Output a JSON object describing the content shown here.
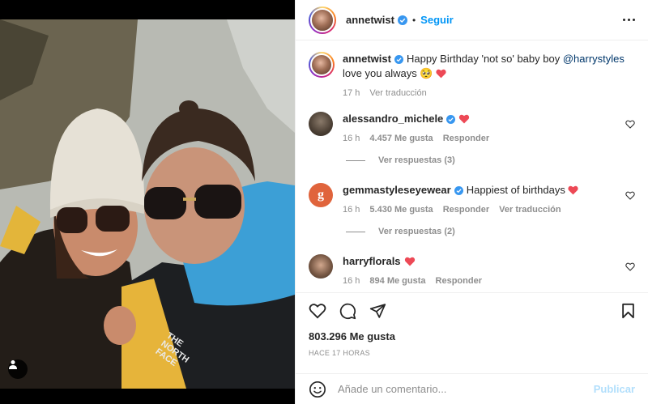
{
  "post": {
    "author": "annetwist",
    "follow_label": "Seguir",
    "caption_user": "annetwist",
    "caption_text": "Happy Birthday 'not so' baby boy",
    "caption_mention": "@harrystyles",
    "caption_tail": "love you always",
    "caption_emoji": "🥺",
    "caption_time": "17 h",
    "caption_translate": "Ver traducción",
    "likes": "803.296 Me gusta",
    "time_ago": "HACE 17 HORAS"
  },
  "comments": [
    {
      "user": "alessandro_michele",
      "verified": true,
      "text": "",
      "time": "16 h",
      "likes": "4.457 Me gusta",
      "reply_label": "Responder",
      "translate_label": "",
      "replies_label": "Ver respuestas (3)"
    },
    {
      "user": "gemmastyleseyewear",
      "verified": true,
      "text": "Happiest of birthdays",
      "time": "16 h",
      "likes": "5.430 Me gusta",
      "reply_label": "Responder",
      "translate_label": "Ver traducción",
      "replies_label": "Ver respuestas (2)"
    },
    {
      "user": "harryflorals",
      "verified": false,
      "text": "",
      "time": "16 h",
      "likes": "894 Me gusta",
      "reply_label": "Responder",
      "translate_label": "",
      "replies_label": ""
    }
  ],
  "composer": {
    "placeholder": "Añade un comentario...",
    "publish_label": "Publicar"
  },
  "icons": {
    "verified": "verified-badge-icon",
    "heart": "heart-icon",
    "comment": "comment-icon",
    "share": "share-icon",
    "save": "bookmark-icon",
    "emoji": "emoji-icon",
    "more": "more-options-icon",
    "tag": "user-tag-icon"
  },
  "colors": {
    "accent": "#0095f6",
    "verified": "#3897f0",
    "heart_red": "#ed4956",
    "muted": "#8e8e8e",
    "publish_disabled": "#b2dffc"
  }
}
